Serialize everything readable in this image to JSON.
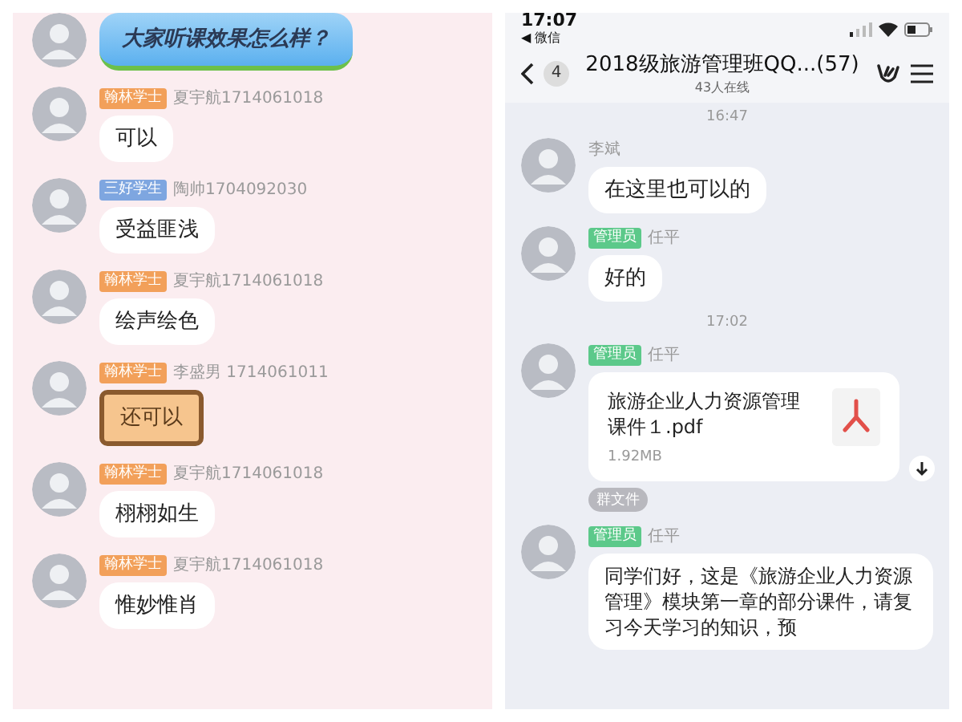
{
  "left_chat": {
    "messages": [
      {
        "kind": "sky",
        "text": "大家听课效果怎么样？"
      },
      {
        "kind": "plain",
        "badge": {
          "text": "翰林学士",
          "color": "#f2a05a"
        },
        "sender": "夏宇航1714061018",
        "text": "可以"
      },
      {
        "kind": "plain",
        "badge": {
          "text": "三好学生",
          "color": "#7ea6e0"
        },
        "sender": "陶帅1704092030",
        "text": "受益匪浅"
      },
      {
        "kind": "plain",
        "badge": {
          "text": "翰林学士",
          "color": "#f2a05a"
        },
        "sender": "夏宇航1714061018",
        "text": "绘声绘色"
      },
      {
        "kind": "frame",
        "badge": {
          "text": "翰林学士",
          "color": "#f2a05a"
        },
        "sender": "李盛男 1714061011",
        "text": "还可以"
      },
      {
        "kind": "plain",
        "badge": {
          "text": "翰林学士",
          "color": "#f2a05a"
        },
        "sender": "夏宇航1714061018",
        "text": "栩栩如生"
      },
      {
        "kind": "plain",
        "badge": {
          "text": "翰林学士",
          "color": "#f2a05a"
        },
        "sender": "夏宇航1714061018",
        "text": "惟妙惟肖"
      }
    ]
  },
  "right_chat": {
    "status_bar": {
      "time": "17:07",
      "back_app": "◀ 微信"
    },
    "header": {
      "unread": "4",
      "title": "2018级旅游管理班QQ...(57)",
      "online": "43人在线"
    },
    "items": [
      {
        "kind": "time",
        "text": "16:47"
      },
      {
        "kind": "text",
        "sender": "李斌",
        "text": "在这里也可以的"
      },
      {
        "kind": "text",
        "badge": {
          "text": "管理员",
          "color": "#5cc98a"
        },
        "sender": "任平",
        "text": "好的"
      },
      {
        "kind": "time",
        "text": "17:02"
      },
      {
        "kind": "file",
        "badge": {
          "text": "管理员",
          "color": "#5cc98a"
        },
        "sender": "任平",
        "file_name": "旅游企业人力资源管理课件１.pdf",
        "file_size": "1.92MB",
        "tag": "群文件"
      },
      {
        "kind": "text",
        "badge": {
          "text": "管理员",
          "color": "#5cc98a"
        },
        "sender": "任平",
        "text": "同学们好，这是《旅游企业人力资源管理》模块第一章的部分课件，请复习今天学习的知识，预"
      }
    ]
  }
}
